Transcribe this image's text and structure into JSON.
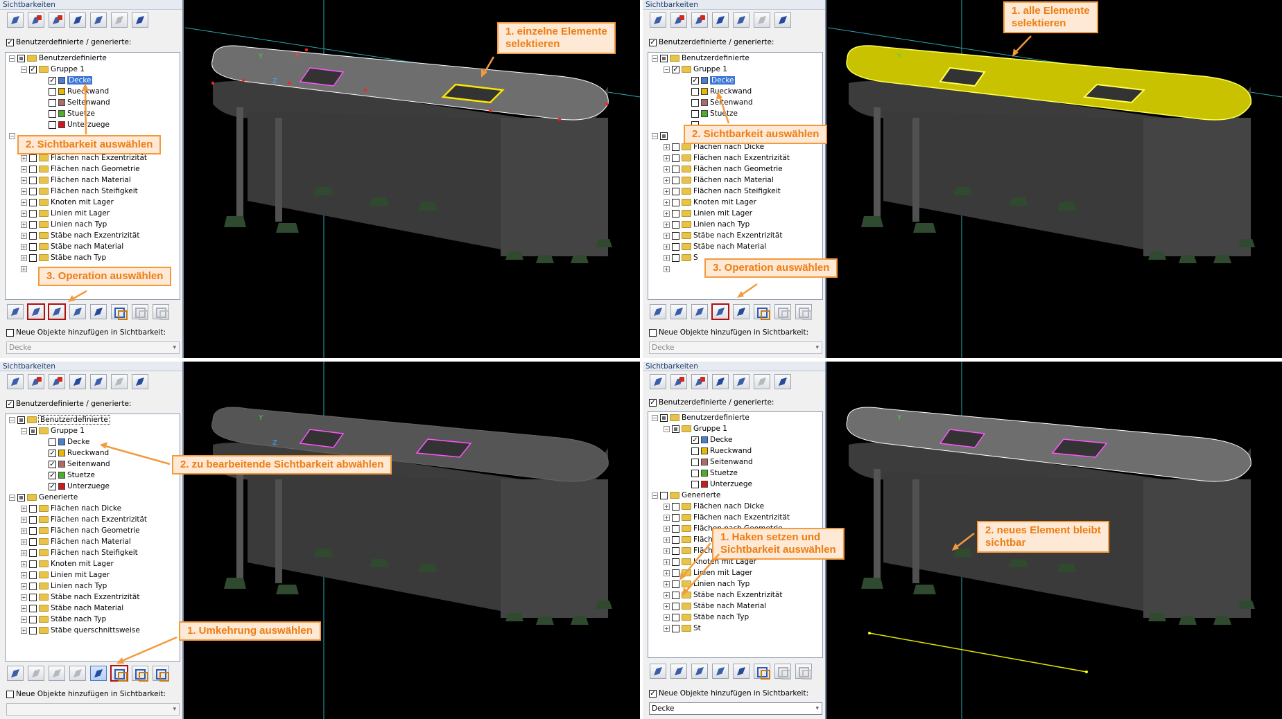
{
  "panel_title": "Sichtbarkeiten",
  "user_generated_label": "Benutzerdefinierte / generierte:",
  "new_objects_label": "Neue Objekte hinzufügen in Sichtbarkeit:",
  "combo_value": "Decke",
  "tree": {
    "user_defined": "Benutzerdefinierte",
    "group1": "Gruppe 1",
    "generated": "Generierte",
    "items": [
      "Decke",
      "Rueckwand",
      "Seitenwand",
      "Stuetze",
      "Unterzuege"
    ],
    "generated_items": [
      "Flächen nach Dicke",
      "Flächen nach Exzentrizität",
      "Flächen nach Geometrie",
      "Flächen nach Material",
      "Flächen nach Steifigkeit",
      "Knoten mit Lager",
      "Linien mit Lager",
      "Linien nach Typ",
      "Stäbe nach Exzentrizität",
      "Stäbe nach Material",
      "Stäbe nach Typ",
      "Stäbe querschnittsweise"
    ],
    "partial_items": {
      "s": "S",
      "stabe_nach_t": "Stäbe nach Typ",
      "st": "St"
    }
  },
  "colors": {
    "decke": "#4a7fd4",
    "rueckwand": "#e6b800",
    "seitenwand": "#b06a6a",
    "stuetze": "#4caf2a",
    "unterzuege": "#d11919",
    "accent": "#f39a3d"
  },
  "callouts": {
    "q0_select": "1. einzelne Elemente\nselektieren",
    "q0_visibility": "2. Sichtbarkeit auswählen",
    "q0_operation": "3. Operation auswählen",
    "q1_select": "1. alle Elemente\nselektieren",
    "q1_visibility": "2. Sichtbarkeit auswählen",
    "q1_operation": "3. Operation auswählen",
    "q2_deselect": "2. zu bearbeitende Sichtbarkeit abwählen",
    "q2_invert": "1. Umkehrung auswählen",
    "q3_check": "1. Haken setzen und\nSichtbarkeit auswählen",
    "q3_new_element": "2. neues Element bleibt\nsichtbar"
  }
}
